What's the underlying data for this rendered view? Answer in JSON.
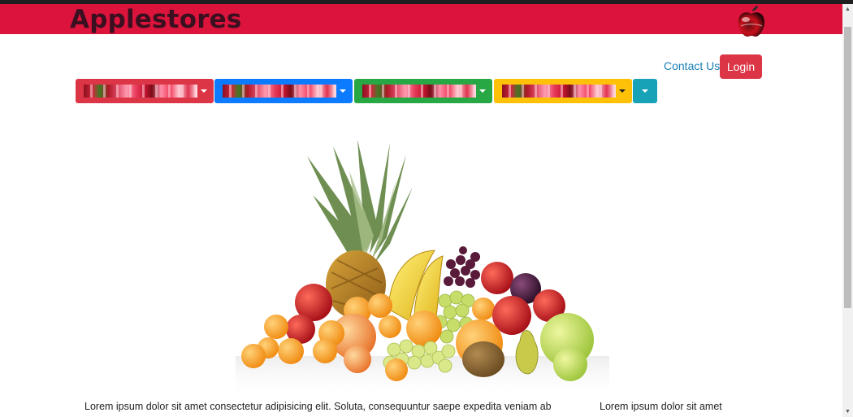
{
  "header": {
    "brand": "Applestores",
    "logo_icon": "apple-logo-icon",
    "background_color": "#dc143c"
  },
  "nav": {
    "contact_label": "Contact Us",
    "login_label": "Login"
  },
  "dropdowns": [
    {
      "color": "#dc3545",
      "icon": "fruit-thumbnail"
    },
    {
      "color": "#0d7bff",
      "icon": "fruit-thumbnail"
    },
    {
      "color": "#28a745",
      "icon": "fruit-thumbnail"
    },
    {
      "color": "#ffc107",
      "icon": "fruit-thumbnail"
    },
    {
      "color": "#17a2b8",
      "icon": "caret-down-icon"
    }
  ],
  "hero": {
    "image_icon": "fruit-arrangement-image"
  },
  "content": {
    "left_text": "Lorem ipsum dolor sit amet consectetur adipisicing elit. Soluta, consequuntur saepe expedita veniam ab",
    "right_text": "Lorem ipsum dolor sit amet"
  }
}
